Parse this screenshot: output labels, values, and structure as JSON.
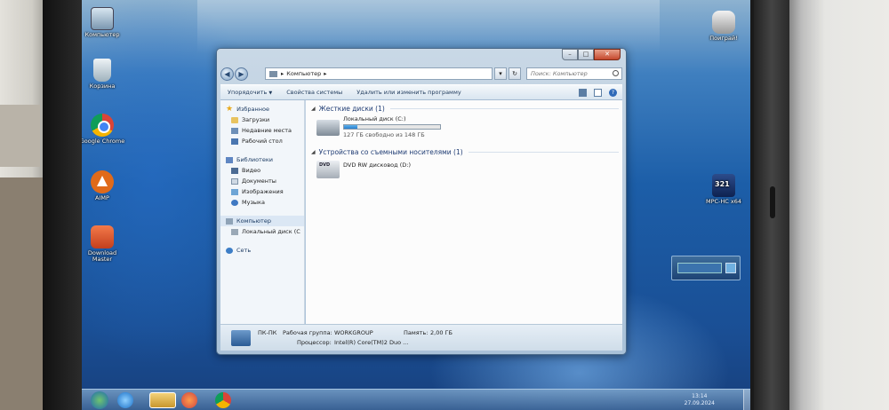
{
  "desktop": {
    "icons": [
      {
        "label": "Компьютер",
        "icon": "computer-icon"
      },
      {
        "label": "Корзина",
        "icon": "recycle-bin-icon"
      },
      {
        "label": "Google Chrome",
        "icon": "chrome-icon"
      },
      {
        "label": "AIMP",
        "icon": "aimp-icon"
      },
      {
        "label": "Download Master",
        "icon": "download-master-icon"
      },
      {
        "label": "Поиграй!",
        "icon": "games-icon"
      },
      {
        "label": "MPC-HC x64",
        "icon": "mpc-icon"
      }
    ]
  },
  "window": {
    "breadcrumb": "Компьютер",
    "breadcrumb_arrow": "▸",
    "search_placeholder": "Поиск: Компьютер",
    "toolbar": {
      "organize": "Упорядочить",
      "system_properties": "Свойства системы",
      "uninstall": "Удалить или изменить программу"
    },
    "nav": {
      "favorites": "Избранное",
      "downloads": "Загрузки",
      "recent": "Недавние места",
      "desktop": "Рабочий стол",
      "libraries": "Библиотеки",
      "video": "Видео",
      "documents": "Документы",
      "images": "Изображения",
      "music": "Музыка",
      "computer": "Компьютер",
      "local_disk": "Локальный диск (C",
      "network": "Сеть"
    },
    "groups": {
      "hard_drives": "Жесткие диски (1)",
      "removable": "Устройства со съемными носителями (1)"
    },
    "drives": {
      "c_name": "Локальный диск (C:)",
      "c_free": "127 ГБ свободно из 148 ГБ",
      "c_used_fraction": 0.14,
      "dvd_name": "DVD RW дисковод (D:)"
    },
    "details": {
      "pc_name": "ПК-ПК",
      "workgroup_label": "Рабочая группа:",
      "workgroup": "WORKGROUP",
      "memory_label": "Память:",
      "memory": "2,00 ГБ",
      "cpu_label": "Процессор:",
      "cpu": "Intel(R) Core(TM)2 Duo ..."
    }
  },
  "taskbar": {
    "time": "13:14",
    "date": "27.09.2024"
  }
}
